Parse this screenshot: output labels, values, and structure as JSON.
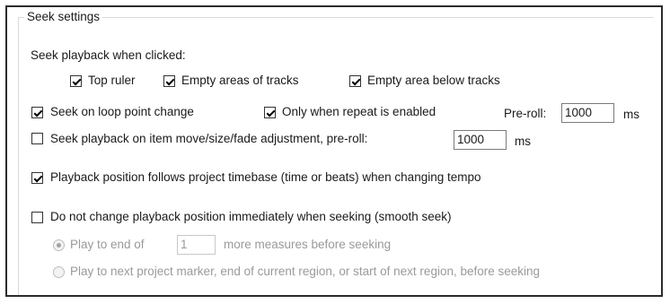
{
  "group": {
    "title": "Seek settings"
  },
  "seek_on_click": {
    "label": "Seek playback when clicked:",
    "top_ruler": {
      "label": "Top ruler",
      "checked": true
    },
    "empty_areas_tracks": {
      "label": "Empty areas of tracks",
      "checked": true
    },
    "empty_area_below": {
      "label": "Empty area below tracks",
      "checked": true
    }
  },
  "loop_point": {
    "label": "Seek on loop point change",
    "checked": true,
    "only_repeat": {
      "label": "Only when repeat is enabled",
      "checked": true
    },
    "preroll_label": "Pre-roll:",
    "preroll_value": "1000",
    "unit": "ms"
  },
  "item_move": {
    "label": "Seek playback on item move/size/fade adjustment, pre-roll:",
    "checked": false,
    "value": "1000",
    "unit": "ms"
  },
  "timebase": {
    "label": "Playback position follows project timebase (time or beats) when changing tempo",
    "checked": true
  },
  "smooth_seek": {
    "label": "Do not change playback position immediately when seeking (smooth seek)",
    "checked": false,
    "option1": {
      "prefix": "Play to end of",
      "value": "1",
      "suffix": "more measures before seeking",
      "selected": true
    },
    "option2": {
      "label": "Play to next project marker, end of current region, or start of next region, before seeking",
      "selected": false
    }
  }
}
